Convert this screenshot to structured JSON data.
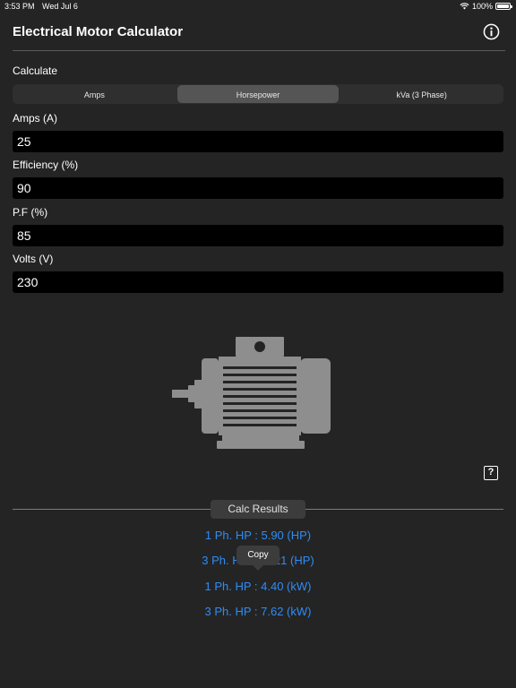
{
  "status": {
    "time": "3:53 PM",
    "date": "Wed Jul 6",
    "battery": "100%"
  },
  "nav": {
    "title": "Electrical Motor Calculator",
    "info_icon": "info-circle-icon"
  },
  "calculate": {
    "label": "Calculate",
    "segments": [
      "Amps",
      "Horsepower",
      "kVa (3 Phase)"
    ],
    "selected": "Horsepower"
  },
  "fields": [
    {
      "label": "Amps (A)",
      "value": "25"
    },
    {
      "label": "Efficiency (%)",
      "value": "90"
    },
    {
      "label": "P.F (%)",
      "value": "85"
    },
    {
      "label": "Volts (V)",
      "value": "230"
    }
  ],
  "image": {
    "icon": "electric-motor-icon"
  },
  "help": {
    "label": "?"
  },
  "results": {
    "badge": "Calc Results",
    "lines": [
      "1 Ph. HP : 5.90 (HP)",
      "3 Ph. HP : 10.21 (HP)",
      "1 Ph. HP : 4.40 (kW)",
      "3 Ph. HP : 7.62 (kW)"
    ],
    "tooltip": "Copy"
  },
  "colors": {
    "background": "#242424",
    "accent": "#2f8cf6",
    "field": "#000000"
  }
}
